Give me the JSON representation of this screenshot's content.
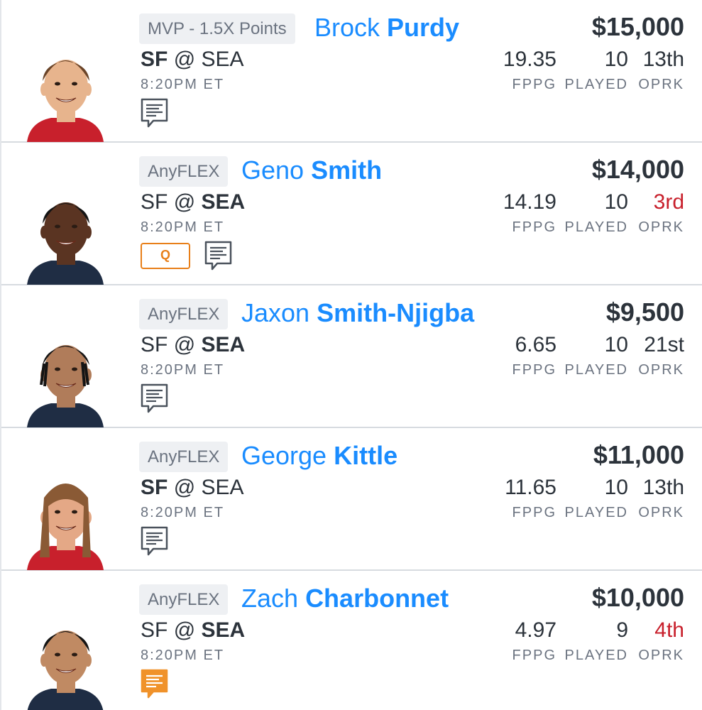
{
  "players": [
    {
      "position": "MVP - 1.5X Points",
      "first_name": "Brock",
      "last_name": "Purdy",
      "away": "SF",
      "home": "SEA",
      "at": "@",
      "bold_team": "away",
      "time": "8:20PM ET",
      "salary": "$15,000",
      "fppg": "19.35",
      "played": "10",
      "oprk": "13th",
      "oprk_highlight": false,
      "injury": "",
      "note_highlight": false,
      "jersey_color": "#c8202c",
      "skin_color": "#e7b48d",
      "hair_color": "#6a4428",
      "hair": "short"
    },
    {
      "position": "AnyFLEX",
      "first_name": "Geno",
      "last_name": "Smith",
      "away": "SF",
      "home": "SEA",
      "at": "@",
      "bold_team": "home",
      "time": "8:20PM ET",
      "salary": "$14,000",
      "fppg": "14.19",
      "played": "10",
      "oprk": "3rd",
      "oprk_highlight": true,
      "injury": "Q",
      "note_highlight": false,
      "jersey_color": "#1f2d44",
      "skin_color": "#5a3422",
      "hair_color": "#141414",
      "hair": "short"
    },
    {
      "position": "AnyFLEX",
      "first_name": "Jaxon",
      "last_name": "Smith-Njigba",
      "away": "SF",
      "home": "SEA",
      "at": "@",
      "bold_team": "home",
      "time": "8:20PM ET",
      "salary": "$9,500",
      "fppg": "6.65",
      "played": "10",
      "oprk": "21st",
      "oprk_highlight": false,
      "injury": "",
      "note_highlight": false,
      "jersey_color": "#1f2d44",
      "skin_color": "#b07c5a",
      "hair_color": "#141414",
      "hair": "braids"
    },
    {
      "position": "AnyFLEX",
      "first_name": "George",
      "last_name": "Kittle",
      "away": "SF",
      "home": "SEA",
      "at": "@",
      "bold_team": "away",
      "time": "8:20PM ET",
      "salary": "$11,000",
      "fppg": "11.65",
      "played": "10",
      "oprk": "13th",
      "oprk_highlight": false,
      "injury": "",
      "note_highlight": false,
      "jersey_color": "#c8202c",
      "skin_color": "#e4a886",
      "hair_color": "#8a5a35",
      "hair": "long"
    },
    {
      "position": "AnyFLEX",
      "first_name": "Zach",
      "last_name": "Charbonnet",
      "away": "SF",
      "home": "SEA",
      "at": "@",
      "bold_team": "home",
      "time": "8:20PM ET",
      "salary": "$10,000",
      "fppg": "4.97",
      "played": "9",
      "oprk": "4th",
      "oprk_highlight": true,
      "injury": "",
      "note_highlight": true,
      "jersey_color": "#1f2d44",
      "skin_color": "#c08a63",
      "hair_color": "#141414",
      "hair": "short"
    }
  ],
  "labels": {
    "fppg": "FPPG",
    "played": "PLAYED",
    "oprk": "OPRK"
  },
  "colors": {
    "accent": "#1a8cff",
    "rank_red": "#c8202c",
    "injury_orange": "#e87f19"
  },
  "icons": {
    "note": "player-news-icon"
  }
}
